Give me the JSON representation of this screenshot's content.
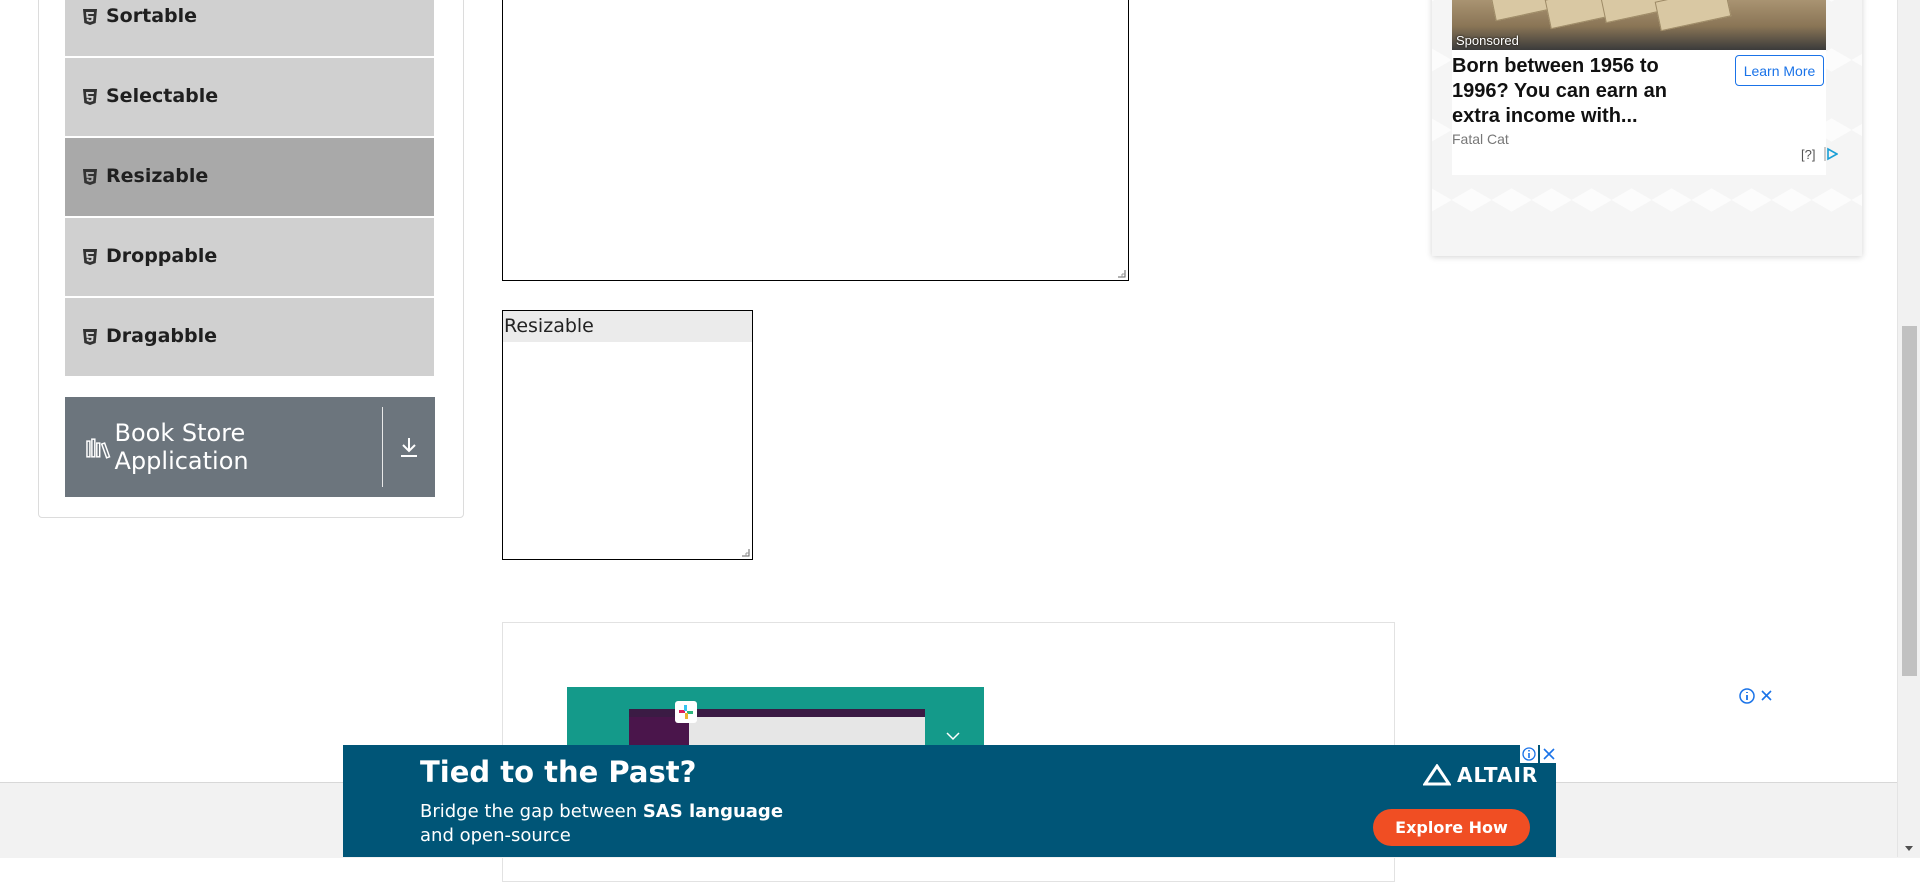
{
  "sidebar": {
    "items": [
      {
        "label": "Sortable",
        "icon": "html5-icon",
        "active": false
      },
      {
        "label": "Selectable",
        "icon": "html5-icon",
        "active": false
      },
      {
        "label": "Resizable",
        "icon": "html5-icon",
        "active": true
      },
      {
        "label": "Droppable",
        "icon": "html5-icon",
        "active": false
      },
      {
        "label": "Dragabble",
        "icon": "html5-icon",
        "active": false
      }
    ],
    "book_store": {
      "label": "Book Store Application",
      "icon": "books-icon",
      "action_icon": "download-icon"
    }
  },
  "main": {
    "resizable_box": {
      "label": "Resizable"
    }
  },
  "sponsored_ad": {
    "badge": "Sponsored",
    "headline": "Born between 1956 to 1996? You can earn an extra income with...",
    "source": "Fatal Cat",
    "cta": "Learn More",
    "ad_choice": "[?]"
  },
  "bottom_banner": {
    "headline": "Tied to the Past?",
    "sub_line1_prefix": "Bridge the gap between ",
    "sub_line1_bold": "SAS language",
    "sub_line2": "and open-source",
    "brand": "ALTAIR",
    "cta": "Explore How"
  },
  "colors": {
    "menu_bg": "#d0d0d0",
    "menu_active_bg": "#a9a9a9",
    "book_btn_bg": "#6c757d",
    "altair_bg": "#005577",
    "altair_cta": "#f04e23",
    "ad_link": "#1a73e8"
  }
}
